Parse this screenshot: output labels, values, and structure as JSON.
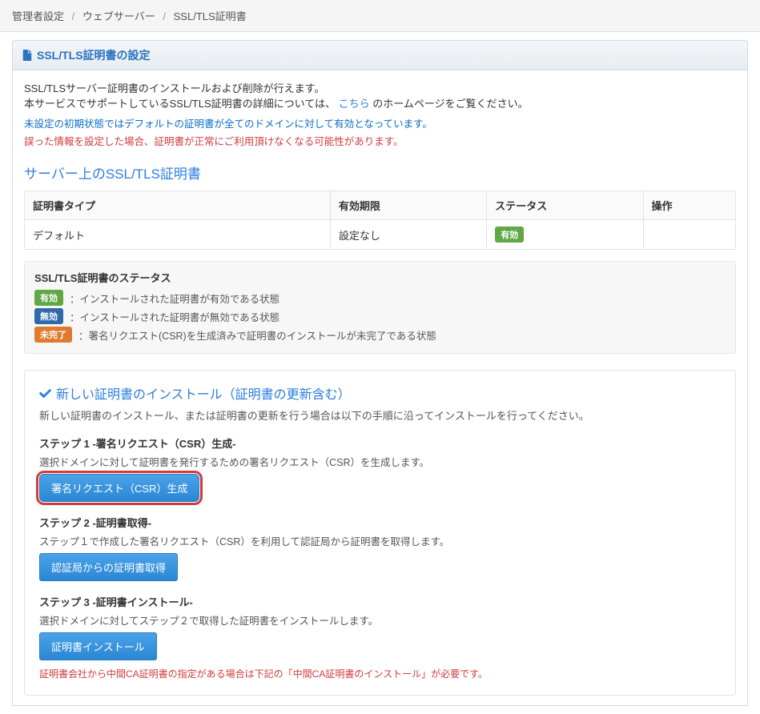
{
  "breadcrumb": {
    "item1": "管理者設定",
    "item2": "ウェブサーバー",
    "item3": "SSL/TLS証明書"
  },
  "panel": {
    "title": "SSL/TLS証明書の設定",
    "desc1": "SSL/TLSサーバー証明書のインストールおよび削除が行えます。",
    "desc2_pre": "本サービスでサポートしているSSL/TLS証明書の詳細については、",
    "desc2_link": "こちら",
    "desc2_post": " のホームページをご覧ください。",
    "note_blue": "未設定の初期状態ではデフォルトの証明書が全てのドメインに対して有効となっています。",
    "note_red": "誤った情報を設定した場合、証明書が正常にご利用頂けなくなる可能性があります。"
  },
  "server_section_title": "サーバー上のSSL/TLS証明書",
  "table": {
    "headers": {
      "type": "証明書タイプ",
      "expiry": "有効期限",
      "status": "ステータス",
      "action": "操作"
    },
    "rows": [
      {
        "type": "デフォルト",
        "expiry": "設定なし",
        "status_label": "有効",
        "action": ""
      }
    ]
  },
  "status_box": {
    "title": "SSL/TLS証明書のステータス",
    "rows": [
      {
        "badge": "有効",
        "badge_class": "badge-green",
        "text": "：インストールされた証明書が有効である状態"
      },
      {
        "badge": "無効",
        "badge_class": "badge-blue",
        "text": "：インストールされた証明書が無効である状態"
      },
      {
        "badge": "未完了",
        "badge_class": "badge-orange",
        "text": "：署名リクエスト(CSR)を生成済みで証明書のインストールが未完了である状態"
      }
    ]
  },
  "install": {
    "title": "新しい証明書のインストール（証明書の更新含む）",
    "desc": "新しい証明書のインストール、または証明書の更新を行う場合は以下の手順に沿ってインストールを行ってください。",
    "step1": {
      "title": "ステップ 1 -署名リクエスト（CSR）生成-",
      "desc": "選択ドメインに対して証明書を発行するための署名リクエスト（CSR）を生成します。",
      "button": "署名リクエスト（CSR）生成"
    },
    "step2": {
      "title": "ステップ 2  -証明書取得-",
      "desc": "ステップ１で作成した署名リクエスト（CSR）を利用して認証局から証明書を取得します。",
      "button": "認証局からの証明書取得"
    },
    "step3": {
      "title": "ステップ 3  -証明書インストール-",
      "desc": "選択ドメインに対してステップ２で取得した証明書をインストールします。",
      "button": "証明書インストール",
      "note": "証明書会社から中間CA証明書の指定がある場合は下記の「中間CA証明書のインストール」が必要です。"
    }
  }
}
